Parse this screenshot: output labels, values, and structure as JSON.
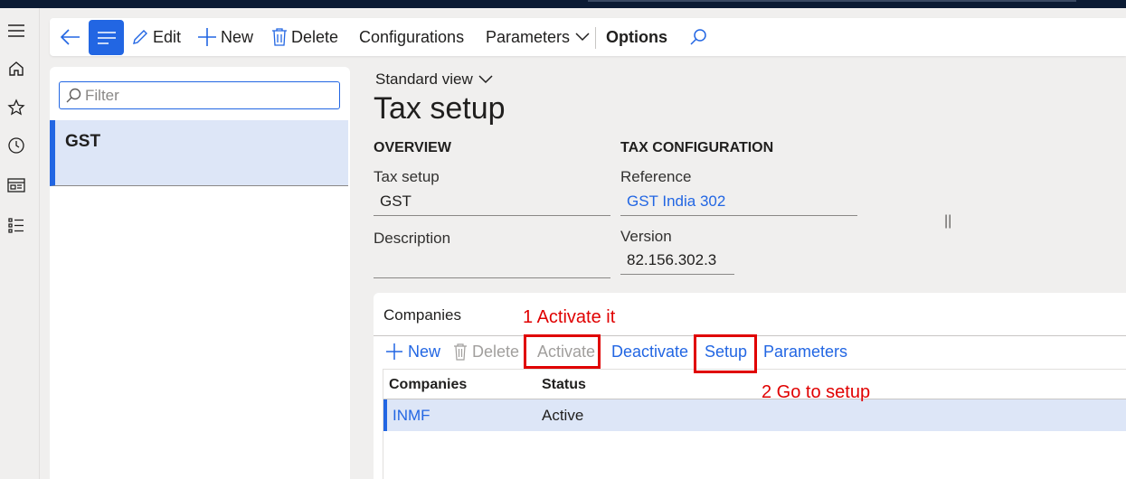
{
  "toolbar": {
    "edit_label": "Edit",
    "new_label": "New",
    "delete_label": "Delete",
    "configurations_label": "Configurations",
    "parameters_label": "Parameters",
    "options_label": "Options"
  },
  "list": {
    "filter_placeholder": "Filter",
    "items": [
      {
        "label": "GST"
      }
    ]
  },
  "main": {
    "view_label": "Standard view",
    "title": "Tax setup",
    "overview": {
      "heading": "OVERVIEW",
      "tax_setup_label": "Tax setup",
      "tax_setup_value": "GST",
      "description_label": "Description",
      "description_value": ""
    },
    "tax_configuration": {
      "heading": "TAX CONFIGURATION",
      "reference_label": "Reference",
      "reference_value": "GST India 302",
      "version_label": "Version",
      "version_value": "82.156.302.3"
    }
  },
  "companies": {
    "title": "Companies",
    "toolbar": {
      "new_label": "New",
      "delete_label": "Delete",
      "activate_label": "Activate",
      "deactivate_label": "Deactivate",
      "setup_label": "Setup",
      "parameters_label": "Parameters"
    },
    "columns": [
      "Companies",
      "Status"
    ],
    "rows": [
      {
        "company": "INMF",
        "status": "Active"
      }
    ]
  },
  "annotations": {
    "step1": "1  Activate it",
    "step2": "2 Go to setup"
  },
  "colors": {
    "accent": "#2266e3",
    "annotation_red": "#e00000",
    "selected_row": "#dde6f7"
  }
}
